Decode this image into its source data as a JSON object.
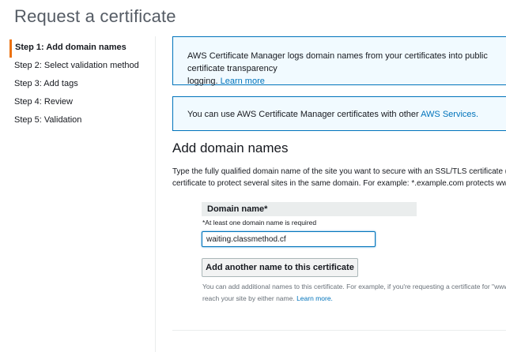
{
  "page": {
    "title": "Request a certificate"
  },
  "steps": [
    {
      "label": "Step 1: Add domain names",
      "active": true
    },
    {
      "label": "Step 2: Select validation method"
    },
    {
      "label": "Step 3: Add tags"
    },
    {
      "label": "Step 4: Review"
    },
    {
      "label": "Step 5: Validation"
    }
  ],
  "info_logging": {
    "text": "AWS Certificate Manager logs domain names from your certificates into public certificate transparency",
    "text2": "logging.",
    "link": "Learn more"
  },
  "info_services": {
    "text": "You can use AWS Certificate Manager certificates with other",
    "link": "AWS Services."
  },
  "section": {
    "title": "Add domain names",
    "intro_line1": "Type the fully qualified domain name of the site you want to secure with an SSL/TLS certificate (for example, www.example.com). Use an asterisk (*) to request a wildcard",
    "intro_line2": "certificate to protect several sites in the same domain. For example: *.example.com protects www.example.com, site.example.com and images.example.com."
  },
  "domain_field": {
    "label": "Domain name*",
    "hint": "*At least one domain name is required",
    "value": "waiting.classmethod.cf"
  },
  "add_button": {
    "label": "Add another name to this certificate"
  },
  "help": {
    "line1": "You can add additional names to this certificate. For example, if you're requesting a certificate for \"www.example.com\", you might want to add the name \"example.com\" so that customers can",
    "line2": "reach your site by either name.",
    "link": "Learn more."
  },
  "colors": {
    "accent": "#ec7211",
    "link": "#0073bb",
    "info_bg": "#f1faff"
  }
}
